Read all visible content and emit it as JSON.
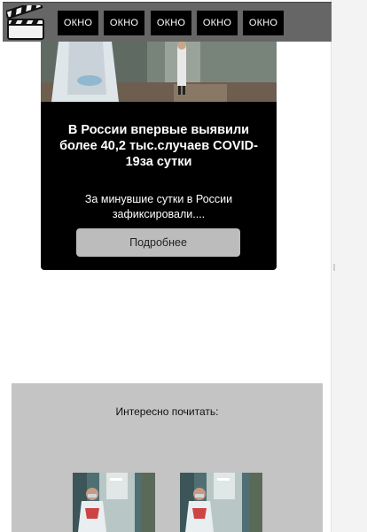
{
  "header": {
    "logo_icon": "clapperboard-icon",
    "nav": [
      "ОКНО",
      "ОКНО",
      "ОКНО",
      "ОКНО",
      "ОКНО"
    ]
  },
  "article": {
    "photo_icon": "medical-staff-corridor-photo",
    "title": "В России впервые выявили более 40,2 тыс.случаев COVID-19за сутки",
    "excerpt": "За минувшие сутки в России зафиксировали....",
    "more_label": "Подробнее"
  },
  "recommended": {
    "heading": "Интересно почитать:",
    "items": [
      {
        "icon": "doctor-in-hallway-photo"
      },
      {
        "icon": "doctor-in-hallway-photo"
      }
    ]
  },
  "colors": {
    "header_bg": "#666666",
    "button_bg": "#000000",
    "card_bg": "#000000",
    "more_btn_bg": "#bcbcbc",
    "reco_bg": "#c4c4c4"
  }
}
